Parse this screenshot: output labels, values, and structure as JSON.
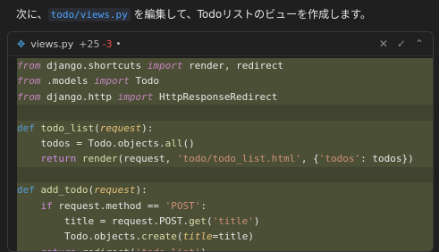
{
  "instruction": {
    "prefix": "次に、",
    "path": "todo/views.py",
    "suffix": " を編集して、Todoリストのビューを作成します。"
  },
  "editor": {
    "file_name": "views.py",
    "additions": "+25",
    "deletions": "-3",
    "icons": {
      "file": "python-file-icon",
      "close": "close-icon",
      "accept": "check-icon",
      "collapse": "chevron-up-icon"
    }
  },
  "code": {
    "lines": [
      "from django.shortcuts import render, redirect",
      "from .models import Todo",
      "from django.http import HttpResponseRedirect",
      "",
      "def todo_list(request):",
      "    todos = Todo.objects.all()",
      "    return render(request, 'todo/todo_list.html', {'todos': todos})",
      "",
      "def add_todo(request):",
      "    if request.method == 'POST':",
      "        title = request.POST.get('title')",
      "        Todo.objects.create(title=title)",
      "    return redirect('todo_list')"
    ]
  }
}
